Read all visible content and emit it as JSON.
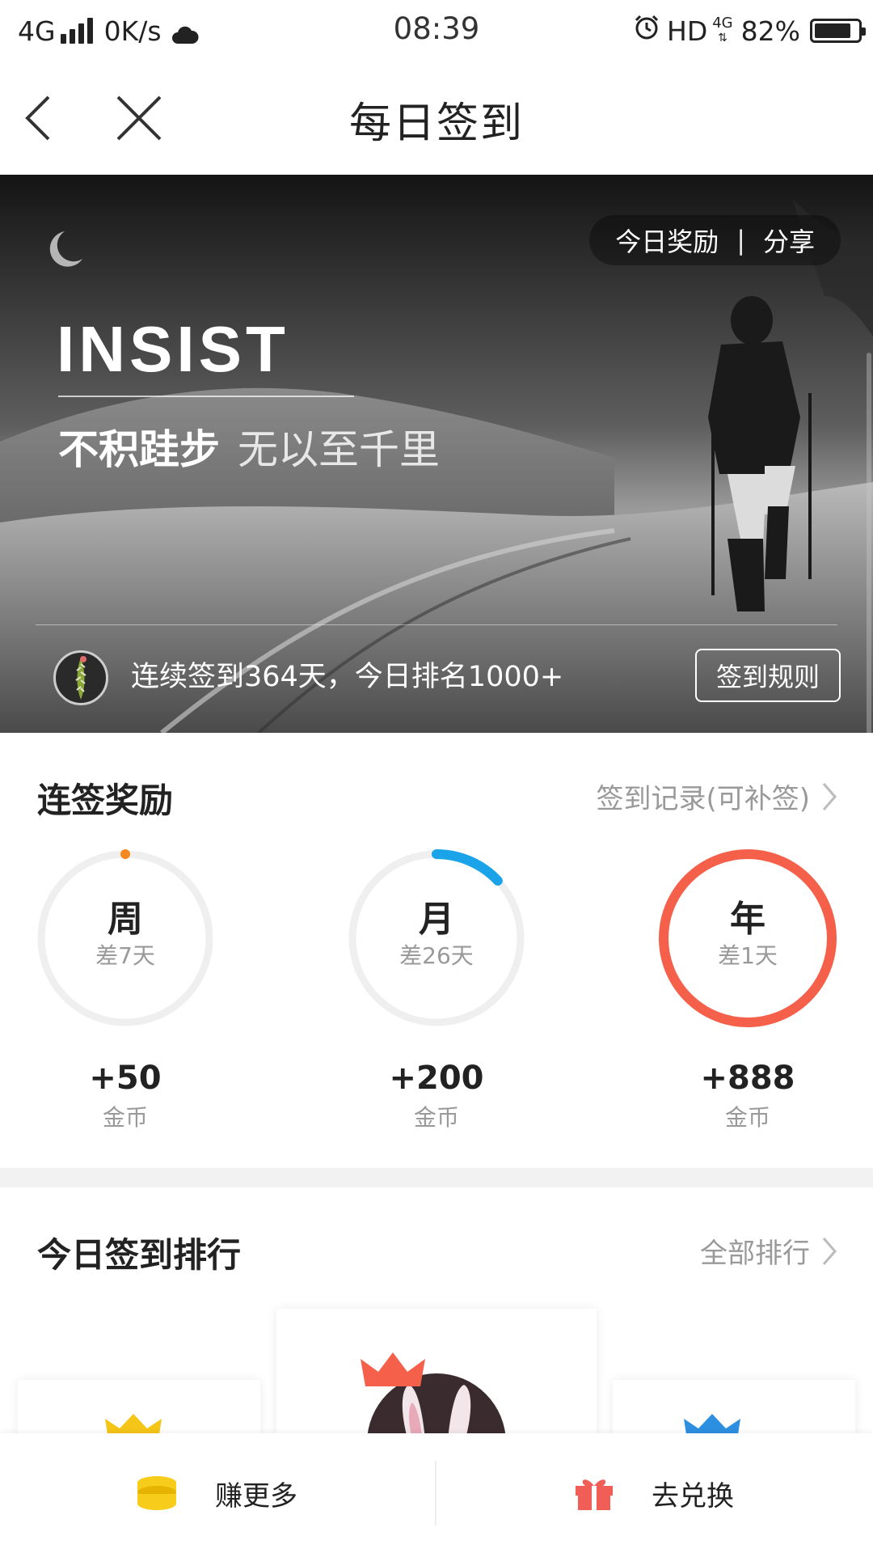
{
  "status_bar": {
    "network": "4G",
    "speed": "0K/s",
    "time": "08:39",
    "hd": "HD",
    "net2": "4G",
    "battery": "82%"
  },
  "titlebar": {
    "title": "每日签到",
    "back_icon": "chevron-left-icon",
    "close_icon": "close-icon"
  },
  "banner": {
    "today_reward": "今日奖励",
    "separator": "|",
    "share": "分享",
    "headline": "INSIST",
    "motto_bold": "不积跬步",
    "motto_light": "无以至千里",
    "streak_text": "连续签到364天，今日排名1000+",
    "rules_button": "签到规则"
  },
  "streak": {
    "title": "连签奖励",
    "record_link": "签到记录(可补签)",
    "items": [
      {
        "label": "周",
        "remaining": "差7天",
        "reward": "+50",
        "unit": "金币",
        "progress": 0.0,
        "color": "#f5891f"
      },
      {
        "label": "月",
        "remaining": "差26天",
        "reward": "+200",
        "unit": "金币",
        "progress": 0.13,
        "color": "#1aa3e8"
      },
      {
        "label": "年",
        "remaining": "差1天",
        "reward": "+888",
        "unit": "金币",
        "progress": 1.0,
        "color": "#f4604a"
      }
    ]
  },
  "ranking": {
    "title": "今日签到排行",
    "all_link": "全部排行"
  },
  "bottom_bar": {
    "earn_more": "赚更多",
    "redeem": "去兑换"
  },
  "colors": {
    "track": "#efefef",
    "coin": "#f7cc1a",
    "gift": "#f15e57"
  }
}
